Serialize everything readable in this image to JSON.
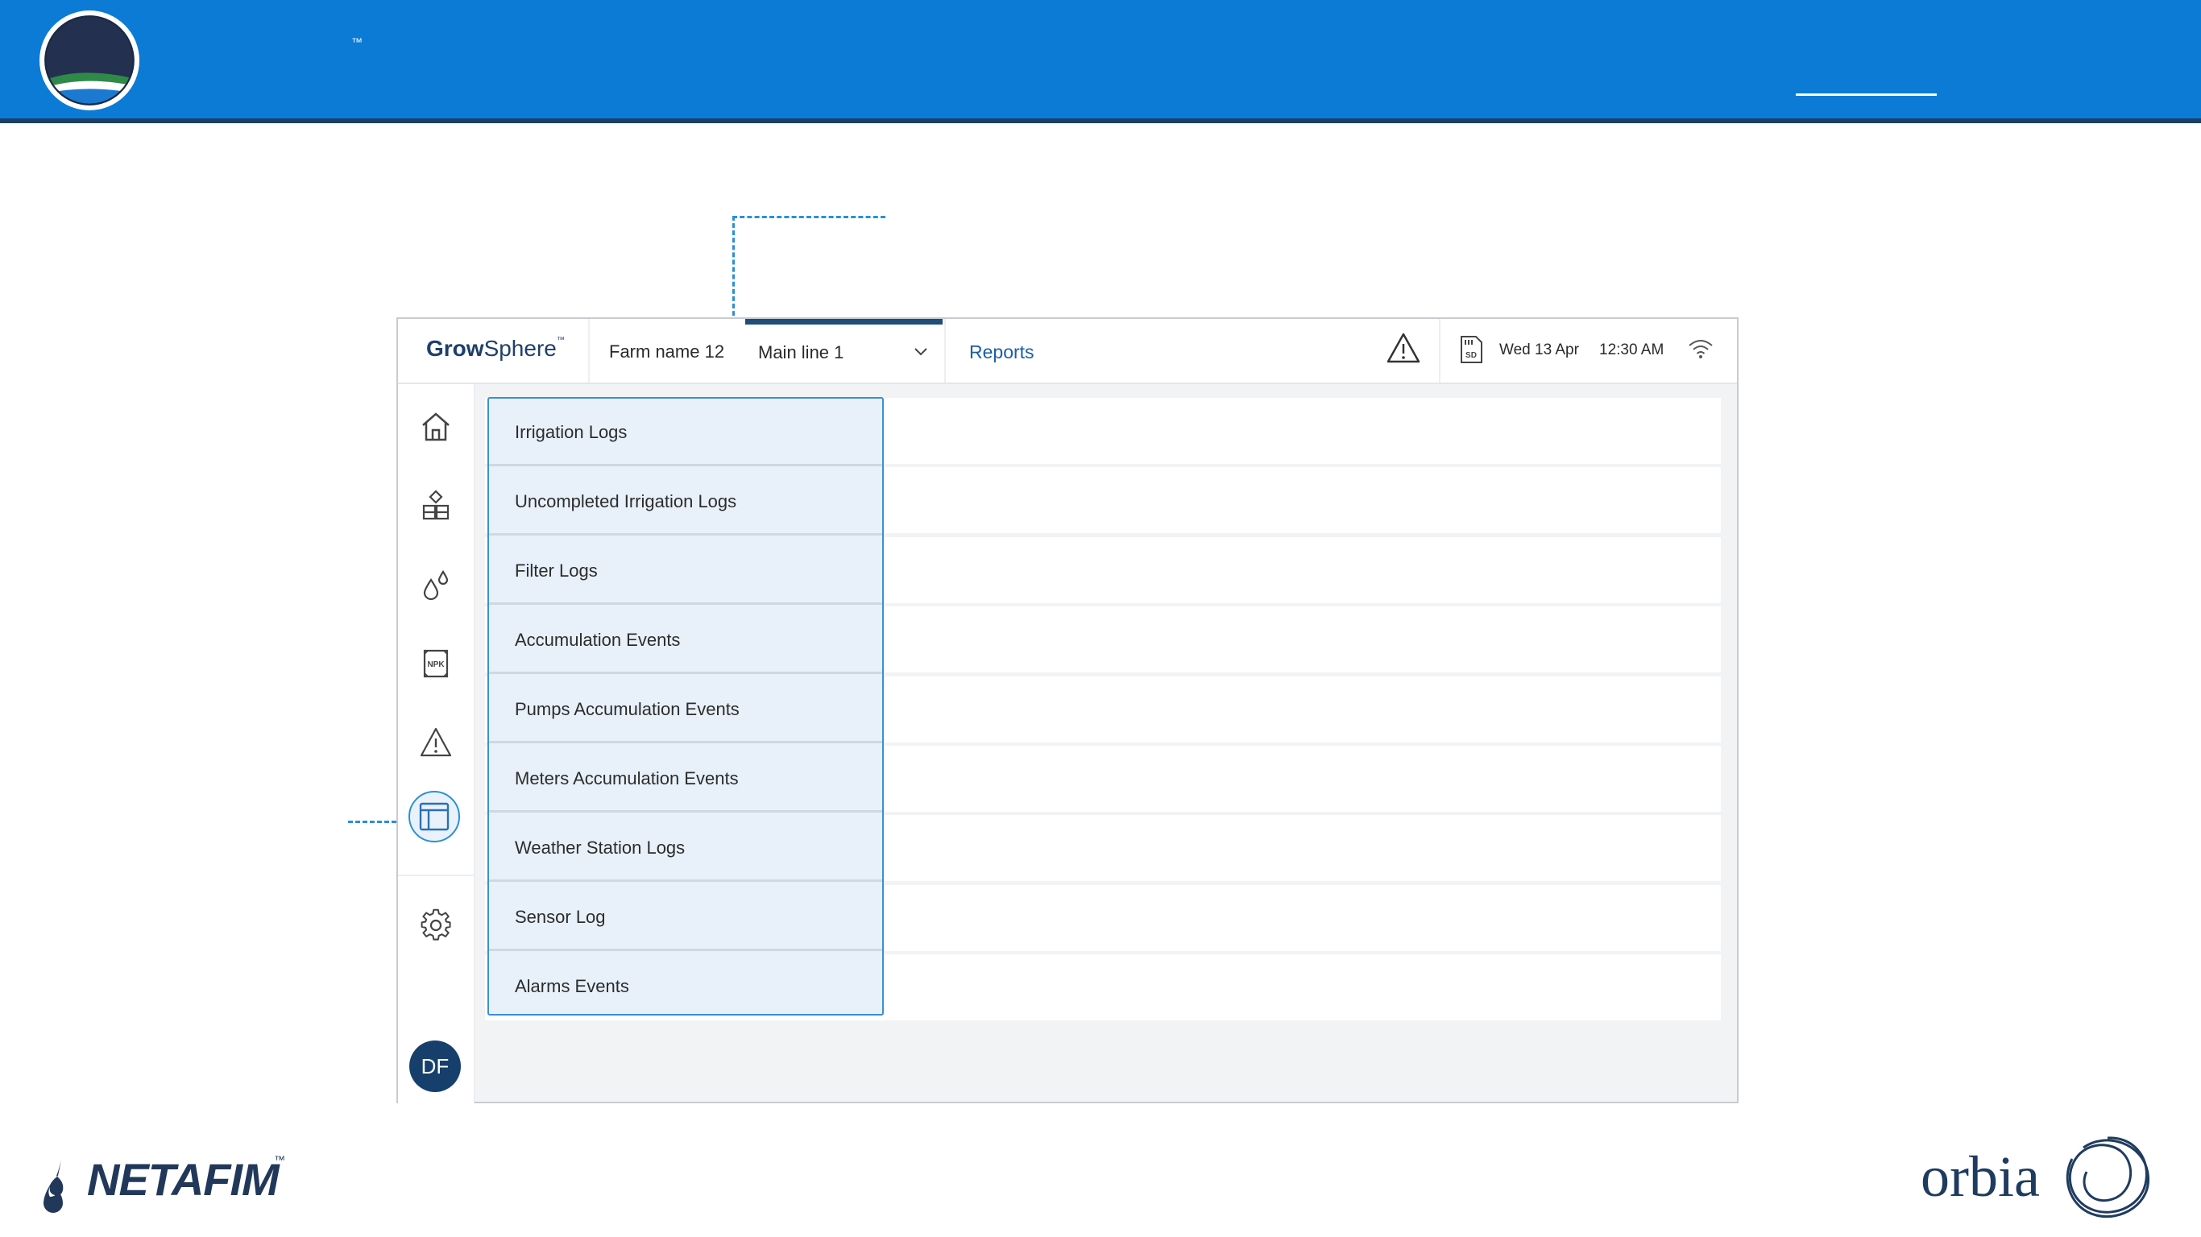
{
  "slide": {
    "trademark": "™",
    "footer_logo_left": "NETAFIM",
    "footer_logo_left_tm": "™",
    "footer_logo_right": "orbia"
  },
  "app": {
    "logo_bold": "Grow",
    "logo_light": "Sphere",
    "logo_tm": "™",
    "farm_name": "Farm name 12",
    "main_line": "Main line 1",
    "reports_label": "Reports",
    "date": "Wed 13 Apr",
    "time": "12:30 AM",
    "avatar_initials": "DF",
    "sd_label": "SD"
  },
  "sidebar": {
    "items": [
      {
        "name": "home-icon"
      },
      {
        "name": "shapes-icon"
      },
      {
        "name": "water-drops-icon"
      },
      {
        "name": "npk-icon",
        "label": "NPK"
      },
      {
        "name": "alert-icon"
      },
      {
        "name": "reports-icon",
        "active": true
      },
      {
        "name": "settings-icon"
      }
    ]
  },
  "reports_menu": {
    "items": [
      "Irrigation Logs",
      "Uncompleted Irrigation Logs",
      "Filter Logs",
      "Accumulation Events",
      "Pumps Accumulation Events",
      "Meters Accumulation Events",
      "Weather Station Logs",
      "Sensor Log",
      "Alarms Events"
    ]
  },
  "colors": {
    "header_blue": "#0b7bd6",
    "navy": "#1f3b5f",
    "accent": "#2a8fd9",
    "dropdown_bg": "#e8f1fa"
  }
}
